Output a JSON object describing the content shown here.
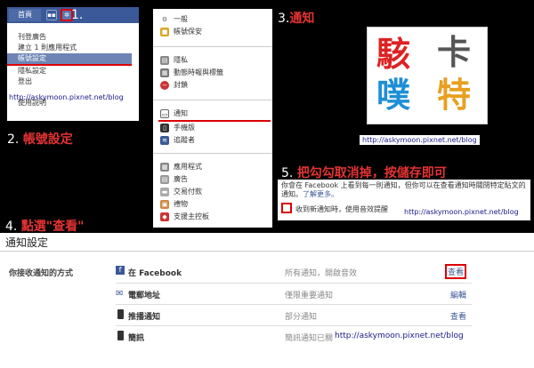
{
  "step1": {
    "label": "1."
  },
  "step2": {
    "num": "2.",
    "text": "帳號設定"
  },
  "step3": {
    "num": "3.",
    "text": "通知"
  },
  "step4": {
    "num": "4.",
    "text": "點選\"查看\""
  },
  "step5": {
    "num": "5.",
    "text": "把勾勾取消掉，按儲存即可"
  },
  "topbar": {
    "home": "首頁"
  },
  "account_menu": {
    "items": [
      "刊登廣告",
      "建立 1 則應用程式",
      "帳號設定",
      "隱私設定",
      "登出",
      "使用說明"
    ]
  },
  "watermark": "http://askymoon.pixnet.net/blog",
  "settings_menu": {
    "group1": [
      "一般",
      "帳號保安"
    ],
    "group2": [
      "隱私",
      "動態時報與標籤",
      "封鎖"
    ],
    "group3": [
      "通知",
      "手機版",
      "追蹤者"
    ],
    "group4": [
      "應用程式",
      "廣告",
      "交易付款",
      "禮物",
      "支援主控板"
    ]
  },
  "logo": {
    "c1": "駭",
    "c2": "卡",
    "c3": "噗",
    "c4": "特"
  },
  "notice": {
    "text": "你會在 Facebook 上看到每一則通知，但你可以在查看通知時關閉特定貼文的通知。",
    "link": "了解更多。",
    "checkbox_label": "收到新通知時，使用音效提醒"
  },
  "notif_settings": {
    "title": "通知設定",
    "receive_label": "你接收通知的方式",
    "rows": [
      {
        "name": "在 Facebook",
        "desc": "所有通知，開啟音效",
        "action": "查看"
      },
      {
        "name": "電郵地址",
        "desc": "僅限重要通知",
        "action": "編輯"
      },
      {
        "name": "推播通知",
        "desc": "部分通知",
        "action": "查看"
      },
      {
        "name": "簡訊",
        "desc": "簡訊通知已關",
        "action": ""
      }
    ]
  },
  "colors": {
    "fb_blue": "#3b5998",
    "highlight_red": "#e53333"
  }
}
